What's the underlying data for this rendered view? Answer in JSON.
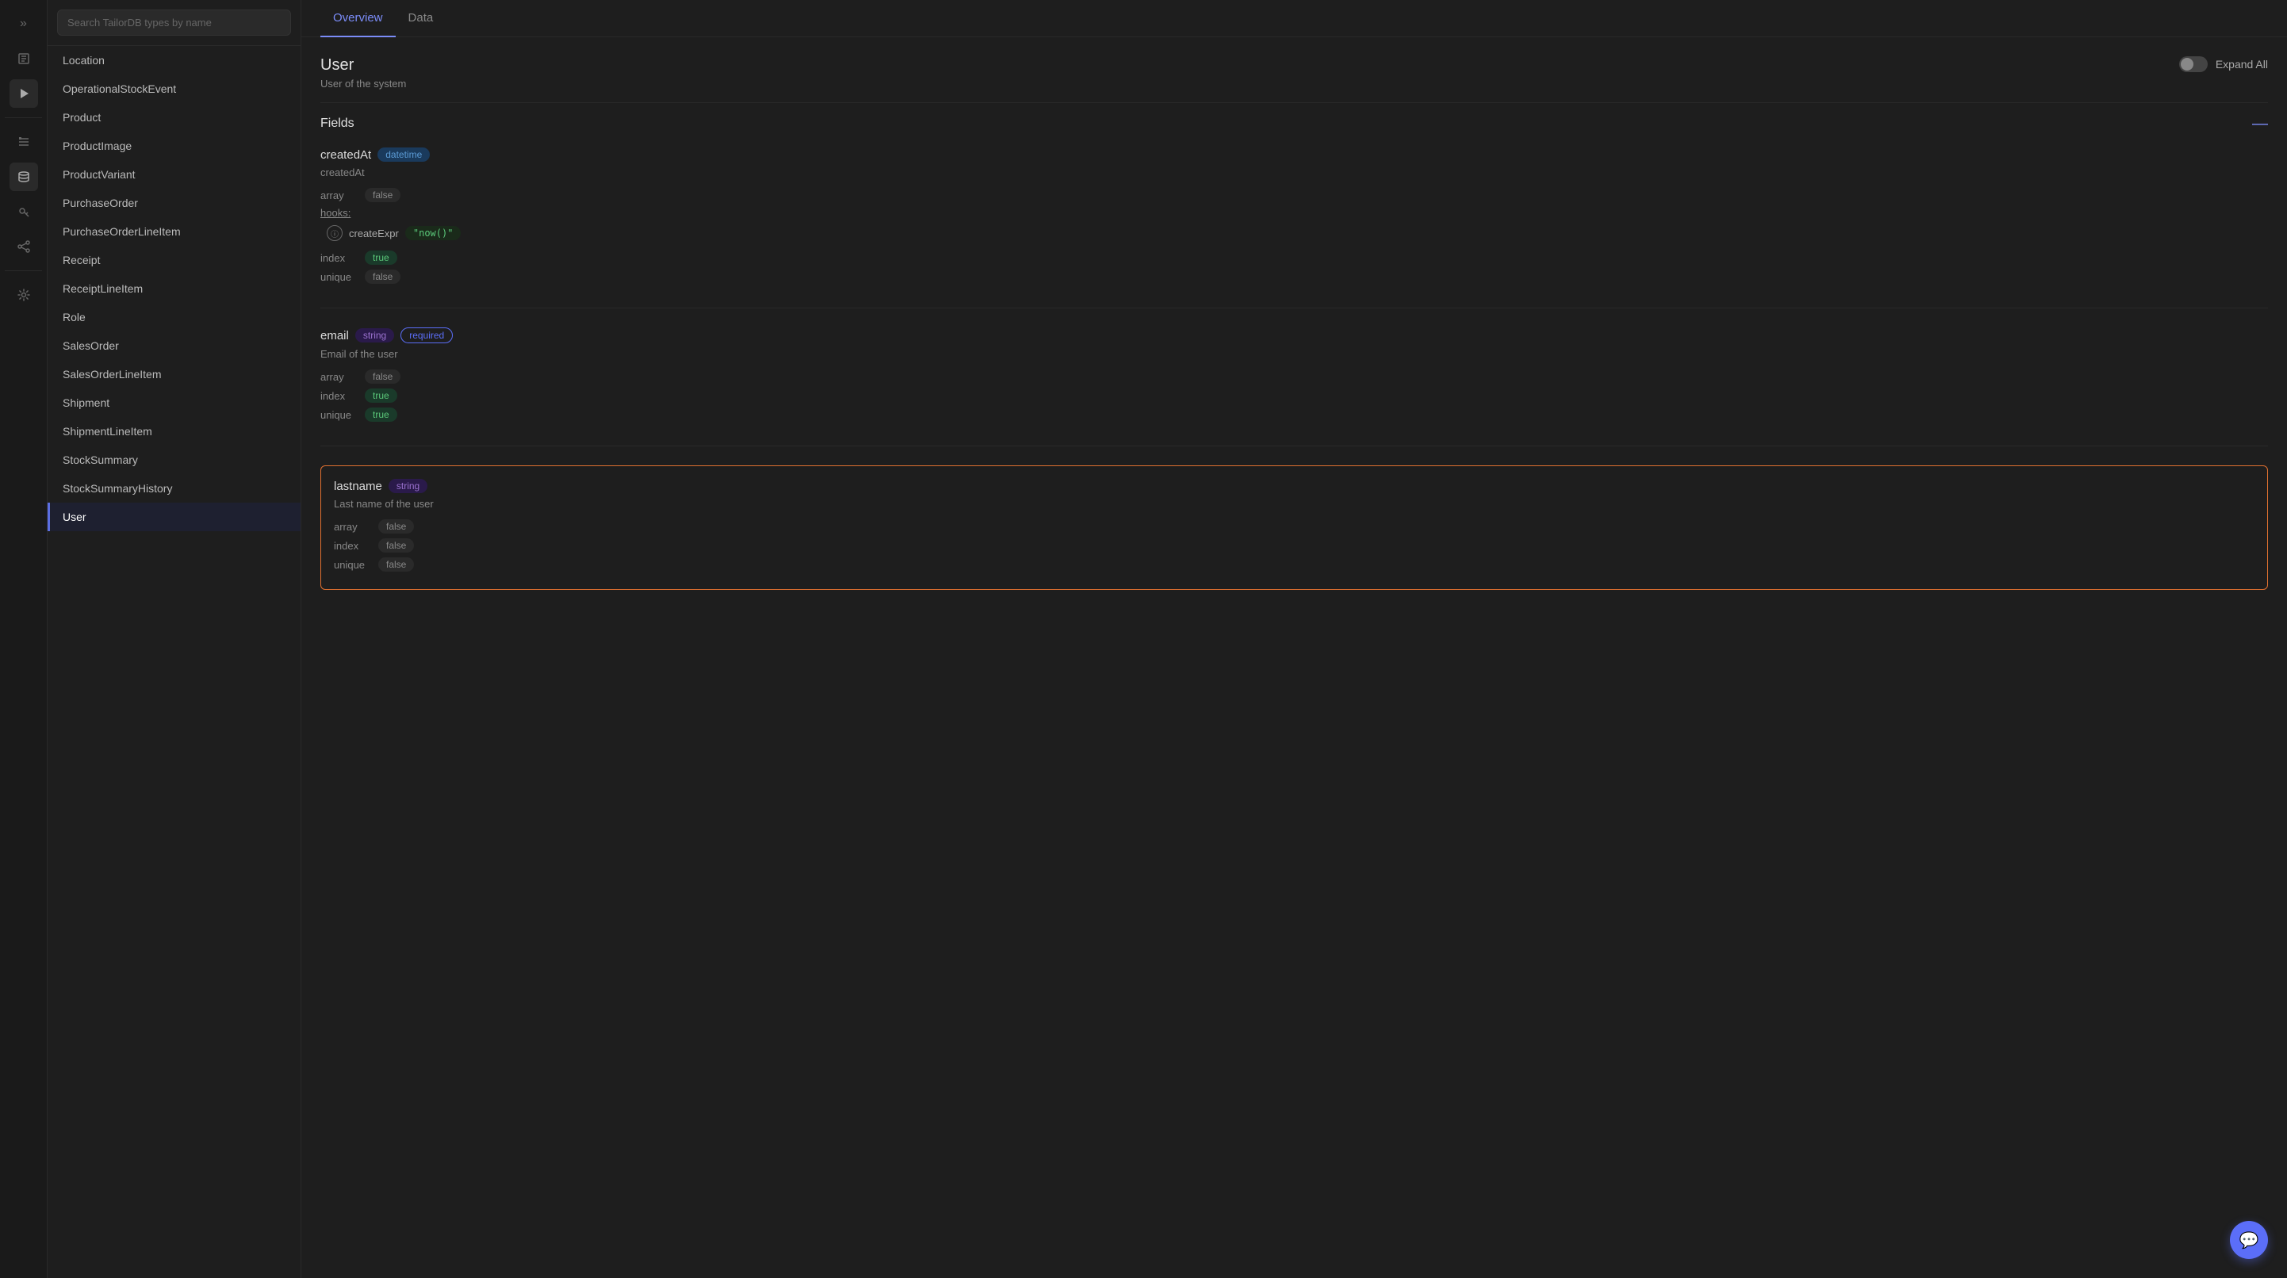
{
  "iconSidebar": {
    "icons": [
      {
        "name": "chevrons-icon",
        "symbol": "»",
        "active": false
      },
      {
        "name": "book-icon",
        "symbol": "📖",
        "active": false
      },
      {
        "name": "play-icon",
        "symbol": "▶",
        "active": true
      },
      {
        "name": "list-icon",
        "symbol": "☰",
        "active": false
      },
      {
        "name": "database-icon",
        "symbol": "🗄",
        "active": true
      },
      {
        "name": "key-icon",
        "symbol": "🔑",
        "active": false
      },
      {
        "name": "share-icon",
        "symbol": "⋈",
        "active": false
      },
      {
        "name": "settings-icon",
        "symbol": "⚙",
        "active": false
      }
    ]
  },
  "search": {
    "placeholder": "Search TailorDB types by name"
  },
  "typeList": {
    "items": [
      {
        "label": "Location"
      },
      {
        "label": "OperationalStockEvent"
      },
      {
        "label": "Product"
      },
      {
        "label": "ProductImage"
      },
      {
        "label": "ProductVariant"
      },
      {
        "label": "PurchaseOrder"
      },
      {
        "label": "PurchaseOrderLineItem"
      },
      {
        "label": "Receipt"
      },
      {
        "label": "ReceiptLineItem"
      },
      {
        "label": "Role"
      },
      {
        "label": "SalesOrder"
      },
      {
        "label": "SalesOrderLineItem"
      },
      {
        "label": "Shipment"
      },
      {
        "label": "ShipmentLineItem"
      },
      {
        "label": "StockSummary"
      },
      {
        "label": "StockSummaryHistory"
      },
      {
        "label": "User"
      }
    ]
  },
  "tabs": [
    {
      "label": "Overview",
      "active": true
    },
    {
      "label": "Data",
      "active": false
    }
  ],
  "typeDetail": {
    "title": "User",
    "description": "User of the system",
    "expandAllLabel": "Expand All"
  },
  "fields": {
    "sectionTitle": "Fields",
    "collapseSymbol": "—",
    "items": [
      {
        "name": "createdAt",
        "type": "datetime",
        "typeBadgeClass": "badge-datetime",
        "extraBadge": null,
        "description": "createdAt",
        "array": "false",
        "arrayClass": "meta-false",
        "hasHooks": true,
        "hookName": "createExpr",
        "hookValue": "\"now()\"",
        "index": "true",
        "indexClass": "meta-true",
        "unique": "false",
        "uniqueClass": "meta-false"
      },
      {
        "name": "email",
        "type": "string",
        "typeBadgeClass": "badge-string",
        "extraBadge": "required",
        "description": "Email of the user",
        "array": "false",
        "arrayClass": "meta-false",
        "hasHooks": false,
        "index": "true",
        "indexClass": "meta-true",
        "unique": "true",
        "uniqueClass": "meta-true"
      },
      {
        "name": "lastname",
        "type": "string",
        "typeBadgeClass": "badge-string",
        "extraBadge": null,
        "description": "Last name of the user",
        "array": "false",
        "arrayClass": "meta-false",
        "hasHooks": false,
        "index": "false",
        "indexClass": "meta-false",
        "unique": "false",
        "uniqueClass": "meta-false",
        "highlighted": true
      }
    ]
  },
  "chat": {
    "icon": "💬"
  }
}
